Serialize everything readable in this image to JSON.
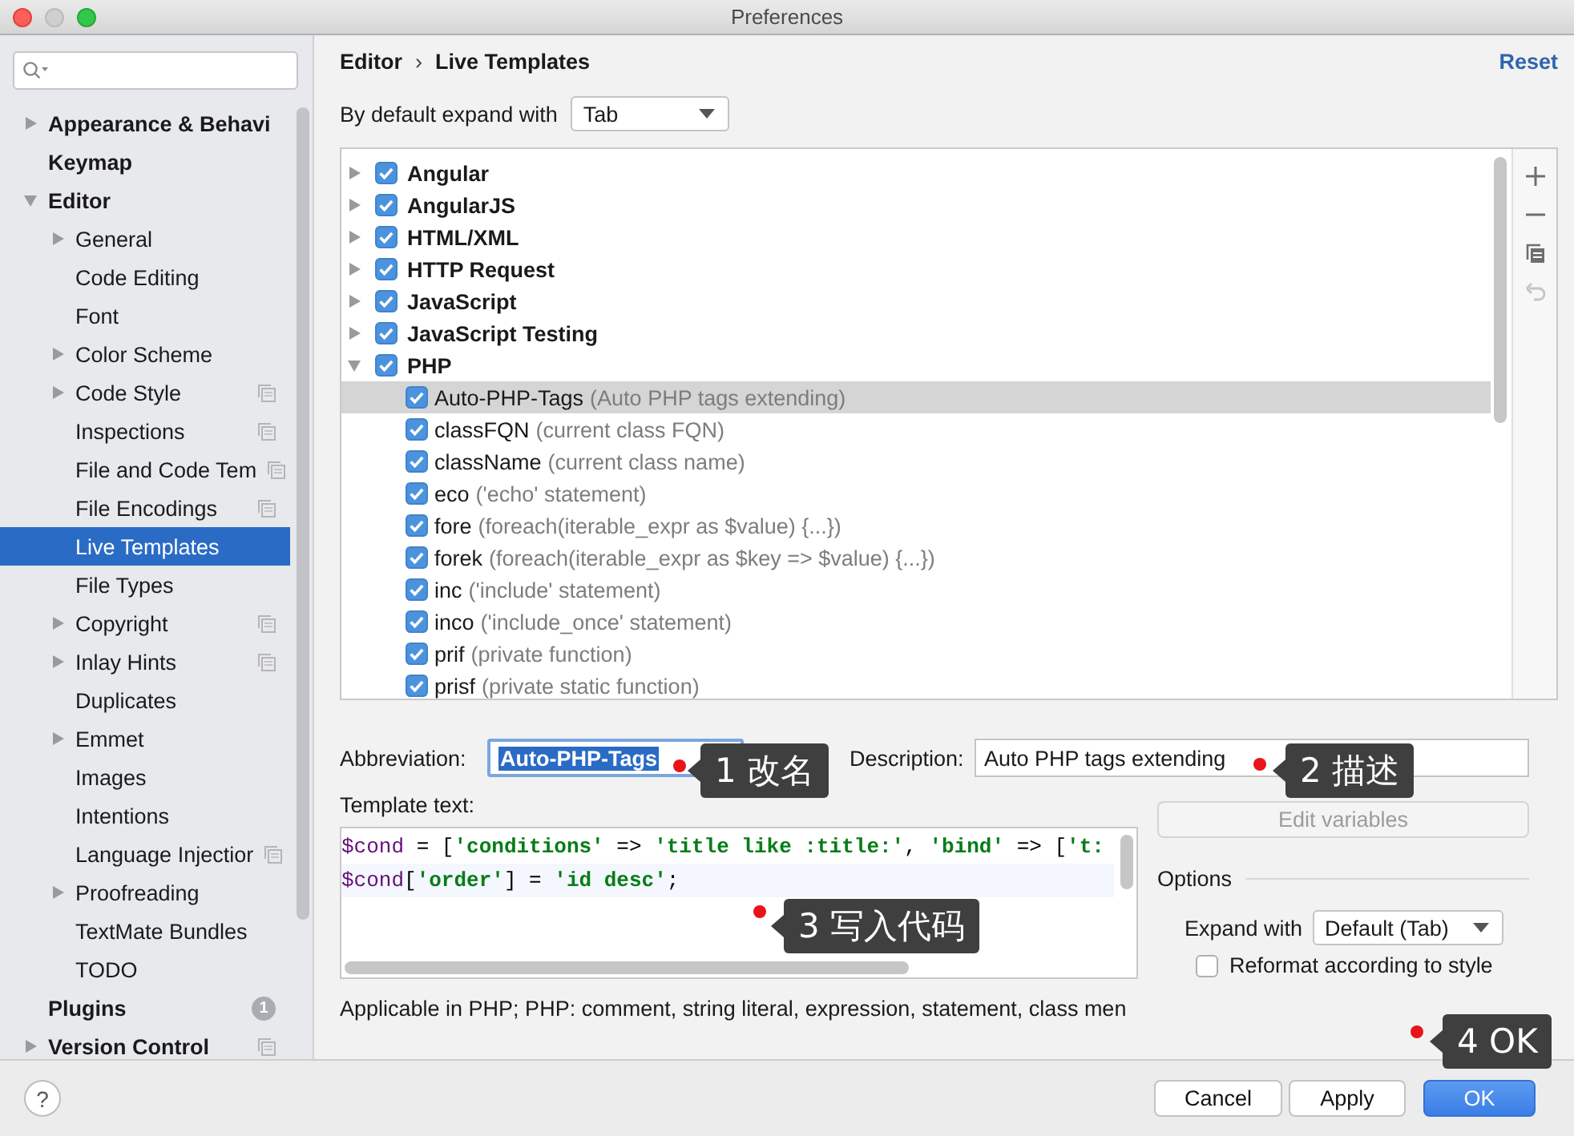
{
  "window": {
    "title": "Preferences"
  },
  "sidebar": {
    "items": [
      {
        "label": "Appearance & Behavi",
        "expanded": false,
        "selected": false,
        "project_level": false
      },
      {
        "label": "Keymap",
        "selected": false,
        "project_level": false
      },
      {
        "label": "Editor",
        "expanded": true,
        "selected": false,
        "project_level": false,
        "children": [
          {
            "label": "General",
            "expanded": false,
            "selected": false,
            "project_level": false
          },
          {
            "label": "Code Editing",
            "selected": false,
            "project_level": false
          },
          {
            "label": "Font",
            "selected": false,
            "project_level": false
          },
          {
            "label": "Color Scheme",
            "expanded": false,
            "selected": false,
            "project_level": false
          },
          {
            "label": "Code Style",
            "expanded": false,
            "selected": false,
            "project_level": true
          },
          {
            "label": "Inspections",
            "selected": false,
            "project_level": true
          },
          {
            "label": "File and Code Tem",
            "selected": false,
            "project_level": true
          },
          {
            "label": "File Encodings",
            "selected": false,
            "project_level": true
          },
          {
            "label": "Live Templates",
            "selected": true,
            "project_level": false
          },
          {
            "label": "File Types",
            "selected": false,
            "project_level": false
          },
          {
            "label": "Copyright",
            "expanded": false,
            "selected": false,
            "project_level": true
          },
          {
            "label": "Inlay Hints",
            "expanded": false,
            "selected": false,
            "project_level": true
          },
          {
            "label": "Duplicates",
            "selected": false,
            "project_level": false
          },
          {
            "label": "Emmet",
            "expanded": false,
            "selected": false,
            "project_level": false
          },
          {
            "label": "Images",
            "selected": false,
            "project_level": false
          },
          {
            "label": "Intentions",
            "selected": false,
            "project_level": false
          },
          {
            "label": "Language Injectior",
            "selected": false,
            "project_level": true
          },
          {
            "label": "Proofreading",
            "expanded": false,
            "selected": false,
            "project_level": false
          },
          {
            "label": "TextMate Bundles",
            "selected": false,
            "project_level": false
          },
          {
            "label": "TODO",
            "selected": false,
            "project_level": false
          }
        ]
      },
      {
        "label": "Plugins",
        "selected": false,
        "project_level": false,
        "count": "1"
      },
      {
        "label": "Version Control",
        "expanded": false,
        "selected": false,
        "project_level": true
      }
    ]
  },
  "header": {
    "breadcrumb": [
      "Editor",
      "Live Templates"
    ],
    "separator": "›",
    "reset": "Reset"
  },
  "expand_default": {
    "label": "By default expand with",
    "value": "Tab"
  },
  "template_groups": [
    {
      "name": "Angular",
      "checked": true,
      "expanded": false
    },
    {
      "name": "AngularJS",
      "checked": true,
      "expanded": false
    },
    {
      "name": "HTML/XML",
      "checked": true,
      "expanded": false
    },
    {
      "name": "HTTP Request",
      "checked": true,
      "expanded": false
    },
    {
      "name": "JavaScript",
      "checked": true,
      "expanded": false
    },
    {
      "name": "JavaScript Testing",
      "checked": true,
      "expanded": false
    },
    {
      "name": "PHP",
      "checked": true,
      "expanded": true,
      "children": [
        {
          "abbreviation": "Auto-PHP-Tags",
          "description": "(Auto PHP tags extending)",
          "checked": true,
          "selected": true
        },
        {
          "abbreviation": "classFQN",
          "description": "(current class FQN)",
          "checked": true,
          "selected": false
        },
        {
          "abbreviation": "className",
          "description": "(current class name)",
          "checked": true,
          "selected": false
        },
        {
          "abbreviation": "eco",
          "description": "('echo' statement)",
          "checked": true,
          "selected": false
        },
        {
          "abbreviation": "fore",
          "description": "(foreach(iterable_expr as $value) {...})",
          "checked": true,
          "selected": false
        },
        {
          "abbreviation": "forek",
          "description": "(foreach(iterable_expr as $key => $value) {...})",
          "checked": true,
          "selected": false
        },
        {
          "abbreviation": "inc",
          "description": "('include' statement)",
          "checked": true,
          "selected": false
        },
        {
          "abbreviation": "inco",
          "description": "('include_once' statement)",
          "checked": true,
          "selected": false
        },
        {
          "abbreviation": "prif",
          "description": "(private function)",
          "checked": true,
          "selected": false
        },
        {
          "abbreviation": "prisf",
          "description": "(private static function)",
          "checked": true,
          "selected": false
        }
      ]
    }
  ],
  "list_toolbar": [
    {
      "kind": "add",
      "disabled": false
    },
    {
      "kind": "remove",
      "disabled": false
    },
    {
      "kind": "copy",
      "disabled": false
    },
    {
      "kind": "undo",
      "disabled": true
    }
  ],
  "abbreviation": {
    "label": "Abbreviation:",
    "value": "Auto-PHP-Tags"
  },
  "description": {
    "label": "Description:",
    "value": "Auto PHP tags extending"
  },
  "template_text": {
    "label": "Template text:",
    "lines": [
      [
        {
          "kind": "var",
          "text": "$cond"
        },
        {
          "kind": "plain",
          "text": " = ["
        },
        {
          "kind": "string",
          "text": "'conditions'"
        },
        {
          "kind": "plain",
          "text": " => "
        },
        {
          "kind": "string",
          "text": "'title like :title:'"
        },
        {
          "kind": "plain",
          "text": ", "
        },
        {
          "kind": "string",
          "text": "'bind'"
        },
        {
          "kind": "plain",
          "text": " => ["
        },
        {
          "kind": "string",
          "text": "'t:"
        }
      ],
      [
        {
          "kind": "var",
          "text": "$cond"
        },
        {
          "kind": "plain",
          "text": "["
        },
        {
          "kind": "string",
          "text": "'order'"
        },
        {
          "kind": "plain",
          "text": "] = "
        },
        {
          "kind": "string",
          "text": "'id desc'"
        },
        {
          "kind": "plain",
          "text": ";"
        }
      ]
    ]
  },
  "edit_variables": {
    "label": "Edit variables",
    "disabled": true
  },
  "options": {
    "title": "Options",
    "expand_with": {
      "label": "Expand with",
      "value": "Default (Tab)"
    },
    "reformat": {
      "label": "Reformat according to style",
      "checked": false
    }
  },
  "applicable": "Applicable in PHP; PHP: comment, string literal, expression, statement, class men",
  "footer": {
    "help": "?",
    "buttons": [
      {
        "label": "Cancel",
        "kind": "normal"
      },
      {
        "label": "Apply",
        "kind": "normal"
      },
      {
        "label": "OK",
        "kind": "default"
      }
    ]
  },
  "annotations": [
    {
      "text": "1 改名"
    },
    {
      "text": "2 描述"
    },
    {
      "text": "3 写入代码"
    },
    {
      "text": "4 OK"
    }
  ]
}
